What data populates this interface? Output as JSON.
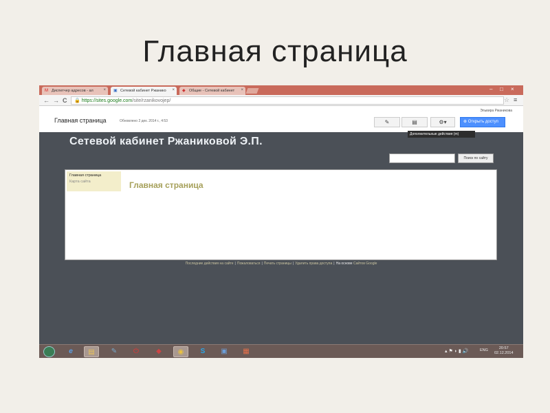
{
  "slide": {
    "title": "Главная страница"
  },
  "browser": {
    "tabs": [
      {
        "label": "Диспетчер адресов - ал",
        "icon": "M"
      },
      {
        "label": "Сетевой кабинет Ржанико",
        "icon": "▣"
      },
      {
        "label": "Общие - Сетевой кабинет",
        "icon": "◆"
      }
    ],
    "close": "×",
    "window_controls": {
      "minimize": "–",
      "maximize": "□",
      "close": "×"
    },
    "nav": {
      "back": "←",
      "forward": "→",
      "reload": "C"
    },
    "address": {
      "lock": "🔒",
      "scheme_host": "https://sites.google.com",
      "path": "/site/rzanikovojep/"
    },
    "star": "☆",
    "menu": "≡"
  },
  "sites_header": {
    "user": "Эльвира Ржаникова",
    "page_title": "Главная страница",
    "updated": "Обновлено 2 дек. 2014 г., 4:53",
    "edit_icon": "✎",
    "new_page_icon": "▤",
    "gear": "⚙▾",
    "share_label": "Открыть доступ",
    "share_icon": "⊕",
    "tooltip": "Дополнительные действия (m)"
  },
  "site": {
    "title": "Сетевой кабинет Ржаниковой Э.П.",
    "search_button": "Поиск по сайту",
    "sidebar": [
      "Главная страница",
      "Карта сайта"
    ],
    "heading": "Главная страница",
    "footer": {
      "links": [
        "Последние действия на сайте",
        "Пожаловаться",
        "Печать страницы",
        "Удалить права доступа"
      ],
      "plain": "На основе",
      "last": "Сайтов Google",
      "separator": "|"
    }
  },
  "taskbar": {
    "apps": [
      "e",
      "▤",
      "✎",
      "⏻",
      "◆",
      "◉",
      "S",
      "▣",
      "▦"
    ],
    "tray": "▴ ⚑ ◗ ▮ 🔊",
    "lang": "ENG",
    "time": "20:57",
    "date": "02.12.2014"
  }
}
